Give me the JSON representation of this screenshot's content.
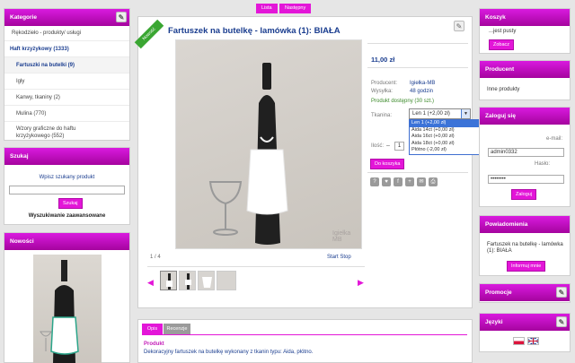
{
  "top_nav": {
    "prev": "Lista",
    "next": "Następny"
  },
  "categories": {
    "title": "Kategorie",
    "items": [
      "Rękodzieło - produkty/ usługi",
      "Haft krzyżykowy (1333)",
      "Fartuszki na butelki (9)",
      "Igły",
      "Kanwy, tkaniny (2)",
      "Mulina (770)",
      "Wzory graficzne do haftu krzyżykowego (552)"
    ]
  },
  "search": {
    "title": "Szukaj",
    "prompt": "Wpisz szukany produkt",
    "button": "Szukaj",
    "advanced": "Wyszukiwanie zaawansowane"
  },
  "news": {
    "title": "Nowości"
  },
  "product": {
    "badge": "Nowość",
    "title": "Fartuszek na butelkę - lamówka (1): BIAŁA",
    "price": "11,00 zł",
    "producer_label": "Producent:",
    "producer": "Igiełka-MB",
    "shipping_label": "Wysyłka:",
    "shipping": "48 godzin",
    "availability": "Produkt dostępny (30 szt.)",
    "fabric_label": "Tkanina:",
    "fabric_selected": "Len 1 (+2,00 zł)",
    "fabric_options": [
      "Len 1 (+2,00 zł)",
      "Aida 14ct (+0,00 zł)",
      "Aida 16ct (+0,00 zł)",
      "Aida 18ct (+0,00 zł)",
      "Płótno (-2,00 zł)"
    ],
    "qty_label": "Ilość:",
    "qty": "1",
    "add_to_cart": "Do koszyka",
    "counter": "1 / 4",
    "slideshow": "Start Stop",
    "watermark": "Igiełka MB"
  },
  "tabs": {
    "description": "Opis",
    "reviews": "Recenzje"
  },
  "description": {
    "heading": "Produkt",
    "text": "Dekoracyjny fartuszek na butelkę wykonany z tkanin typu: Aida, płótno."
  },
  "cart": {
    "title": "Koszyk",
    "text": "...jest pusty",
    "button": "Zobacz"
  },
  "producer_box": {
    "title": "Producent",
    "text": "Inne produkty"
  },
  "login": {
    "title": "Zaloguj się",
    "email_label": "e-mail:",
    "email": "admin0332",
    "password_label": "Hasło:",
    "password": "••••••••",
    "button": "Zaloguj"
  },
  "notify": {
    "title": "Powiadomienia",
    "text": "Fartuszek na butelkę - lamówka (1): BIAŁA",
    "button": "Informuj mnie"
  },
  "promo": {
    "title": "Promocje"
  },
  "languages": {
    "title": "Języki"
  },
  "colors": {
    "accent": "#d314cf",
    "link": "#1a3d8f",
    "price": "#1a3d8f",
    "available": "#3b8a2a"
  }
}
